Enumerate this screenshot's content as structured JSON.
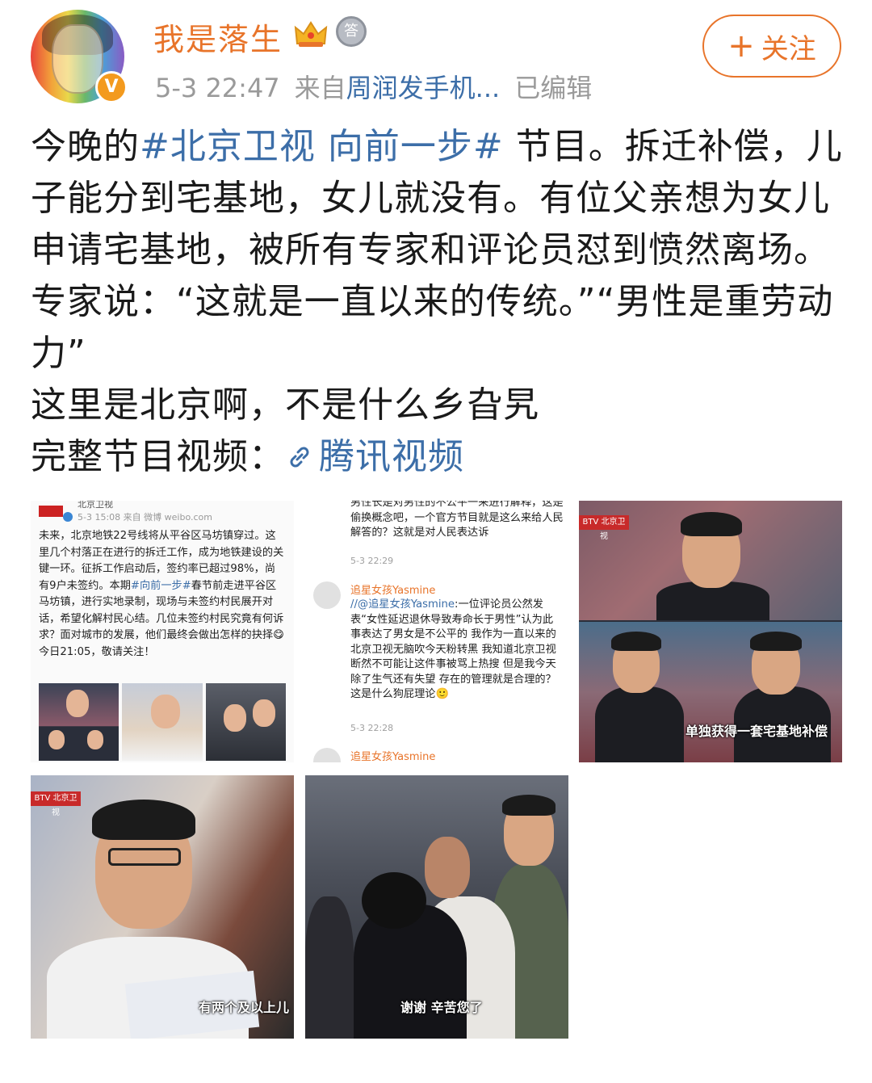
{
  "user": {
    "name": "我是落生",
    "verified_badge": "V",
    "medal_label": "答"
  },
  "meta": {
    "time": "5-3 22:47",
    "from_prefix": "来自",
    "source": "周润发手机...",
    "edited": "已编辑"
  },
  "follow": {
    "plus": "+",
    "label": "关注"
  },
  "post": {
    "pre": "今晚的",
    "hashtag": "#北京卫视 向前一步#",
    "main": " 节目。拆迁补偿，儿子能分到宅基地，女儿就没有。有位父亲想为女儿申请宅基地，被所有专家和评论员怼到愤然离场。专家说：“这就是一直以来的传统。”“男性是重劳动力”",
    "line2": "这里是北京啊，不是什么乡旮旯",
    "video_prefix": "完整节目视频：",
    "video_link": "腾讯视频"
  },
  "images": {
    "img1": {
      "header": "北京卫视",
      "meta": "5-3 15:08  来自 微博 weibo.com",
      "text_a": "未来，北京地铁22号线将从平谷区马坊镇穿过。这里几个村落正在进行的拆迁工作，成为地铁建设的关键一环。征拆工作启动后，签约率已超过98%，尚有9户未签约。本期",
      "hashtag": "#向前一步#",
      "text_b": "春节前走进平谷区马坊镇，进行实地录制，现场与未签约村民展开对话，希望化解村民心结。几位未签约村民究竟有何诉求？面对城市的发展，他们最终会做出怎样的抉择😋今日21:05，敬请关注！"
    },
    "img2": {
      "top_text": "男性长是对男性的不公平一来进行解释，这是偷换概念吧，一个官方节目就是这么来给人民解答的？这就是对人民表达诉",
      "time1": "5-3 22:29",
      "user": "追星女孩Yasmine",
      "body_at": "//@追星女孩Yasmine",
      "body": ":一位评论员公然发表“女性延迟退休导致寿命长于男性”认为此事表达了男女是不公平的 我作为一直以来的北京卫视无脑吹今天粉转黑 我知道北京卫视断然不可能让这件事被骂上热搜 但是我今天除了生气还有失望 存在的管理就是合理的？这是什么狗屁理论🙂",
      "time2": "5-3 22:28",
      "user2": "追星女孩Yasmine"
    },
    "img3": {
      "logo": "BTV 北京卫视",
      "caption": "单独获得一套宅基地补偿"
    },
    "img4": {
      "logo": "BTV 北京卫视",
      "caption": "有两个及以上儿"
    },
    "img5": {
      "caption": "谢谢 辛苦您了"
    }
  },
  "colors": {
    "accent_orange": "#e8742a",
    "link_blue": "#3c6ea8",
    "meta_gray": "#9a9a9a"
  }
}
